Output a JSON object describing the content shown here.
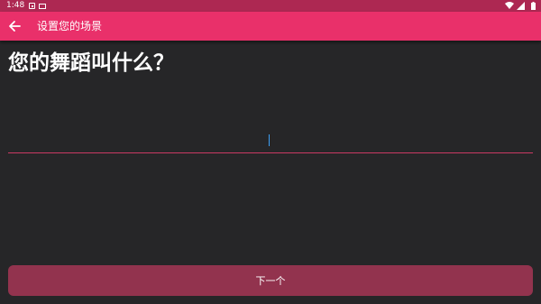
{
  "status_bar": {
    "time": "1:48",
    "icons": [
      "notification-icon",
      "keyboard-icon",
      "wifi-icon",
      "signal-icon",
      "battery-icon"
    ]
  },
  "app_bar": {
    "back_icon": "arrow-left-icon",
    "title": "设置您的场景"
  },
  "main": {
    "question": "您的舞蹈叫什么？",
    "input_value": ""
  },
  "footer": {
    "next_label": "下一个"
  },
  "colors": {
    "status_bar": "#ad2852",
    "app_bar": "#e9306a",
    "background": "#262628",
    "underline": "#c93a64",
    "button": "#92334e",
    "caret": "#3ea0f5"
  }
}
